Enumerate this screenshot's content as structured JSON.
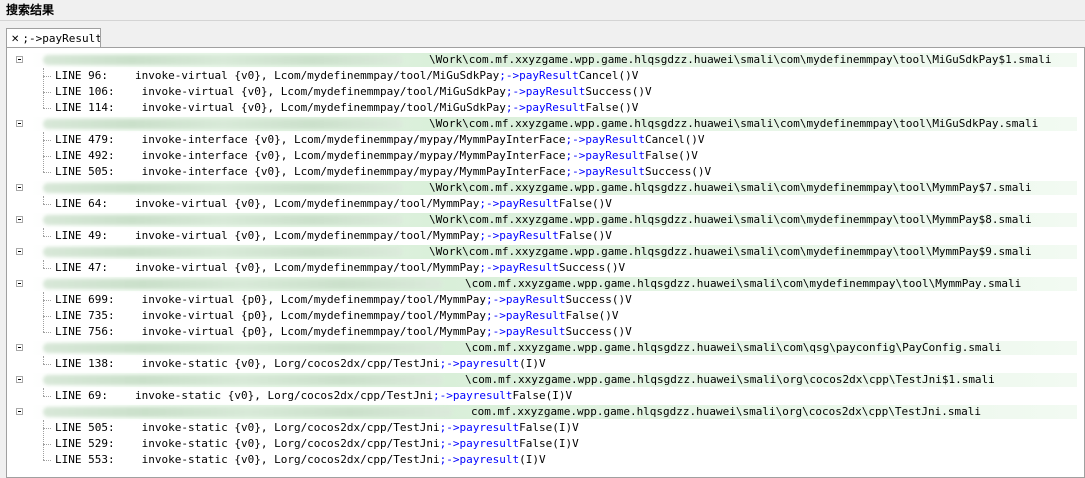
{
  "panel": {
    "title": "搜索结果"
  },
  "tab": {
    "label": ";->payResult"
  },
  "groups": [
    {
      "path": "\\Work\\com.mf.xxyzgame.wpp.game.hlqsgdzz.huawei\\smali\\com\\mydefinemmpay\\tool\\MiGuSdkPay$1.smali",
      "items": [
        {
          "line": "LINE 96:",
          "pre": "invoke-virtual {v0}, Lcom/mydefinemmpay/tool/MiGuSdkPay",
          "match": ";->payResult",
          "post": "Cancel()V"
        },
        {
          "line": "LINE 106:",
          "pre": " invoke-virtual {v0}, Lcom/mydefinemmpay/tool/MiGuSdkPay",
          "match": ";->payResult",
          "post": "Success()V"
        },
        {
          "line": "LINE 114:",
          "pre": " invoke-virtual {v0}, Lcom/mydefinemmpay/tool/MiGuSdkPay",
          "match": ";->payResult",
          "post": "False()V"
        }
      ]
    },
    {
      "path": "\\Work\\com.mf.xxyzgame.wpp.game.hlqsgdzz.huawei\\smali\\com\\mydefinemmpay\\tool\\MiGuSdkPay.smali",
      "items": [
        {
          "line": "LINE 479:",
          "pre": " invoke-interface {v0}, Lcom/mydefinemmpay/mypay/MymmPayInterFace",
          "match": ";->payResult",
          "post": "Cancel()V"
        },
        {
          "line": "LINE 492:",
          "pre": " invoke-interface {v0}, Lcom/mydefinemmpay/mypay/MymmPayInterFace",
          "match": ";->payResult",
          "post": "False()V"
        },
        {
          "line": "LINE 505:",
          "pre": " invoke-interface {v0}, Lcom/mydefinemmpay/mypay/MymmPayInterFace",
          "match": ";->payResult",
          "post": "Success()V"
        }
      ]
    },
    {
      "path": "\\Work\\com.mf.xxyzgame.wpp.game.hlqsgdzz.huawei\\smali\\com\\mydefinemmpay\\tool\\MymmPay$7.smali",
      "items": [
        {
          "line": "LINE 64:",
          "pre": "invoke-virtual {v0}, Lcom/mydefinemmpay/tool/MymmPay",
          "match": ";->payResult",
          "post": "False()V"
        }
      ]
    },
    {
      "path": "\\Work\\com.mf.xxyzgame.wpp.game.hlqsgdzz.huawei\\smali\\com\\mydefinemmpay\\tool\\MymmPay$8.smali",
      "items": [
        {
          "line": "LINE 49:",
          "pre": "invoke-virtual {v0}, Lcom/mydefinemmpay/tool/MymmPay",
          "match": ";->payResult",
          "post": "False()V"
        }
      ]
    },
    {
      "path": "\\Work\\com.mf.xxyzgame.wpp.game.hlqsgdzz.huawei\\smali\\com\\mydefinemmpay\\tool\\MymmPay$9.smali",
      "items": [
        {
          "line": "LINE 47:",
          "pre": "invoke-virtual {v0}, Lcom/mydefinemmpay/tool/MymmPay",
          "match": ";->payResult",
          "post": "Success()V"
        }
      ]
    },
    {
      "path": "\\com.mf.xxyzgame.wpp.game.hlqsgdzz.huawei\\smali\\com\\mydefinemmpay\\tool\\MymmPay.smali",
      "items": [
        {
          "line": "LINE 699:",
          "pre": " invoke-virtual {p0}, Lcom/mydefinemmpay/tool/MymmPay",
          "match": ";->payResult",
          "post": "Success()V"
        },
        {
          "line": "LINE 735:",
          "pre": " invoke-virtual {p0}, Lcom/mydefinemmpay/tool/MymmPay",
          "match": ";->payResult",
          "post": "False()V"
        },
        {
          "line": "LINE 756:",
          "pre": " invoke-virtual {p0}, Lcom/mydefinemmpay/tool/MymmPay",
          "match": ";->payResult",
          "post": "Success()V"
        }
      ]
    },
    {
      "path": "\\com.mf.xxyzgame.wpp.game.hlqsgdzz.huawei\\smali\\com\\qsg\\payconfig\\PayConfig.smali",
      "items": [
        {
          "line": "LINE 138:",
          "pre": " invoke-static {v0}, Lorg/cocos2dx/cpp/TestJni",
          "match": ";->payresult",
          "post": "(I)V"
        }
      ]
    },
    {
      "path": "\\com.mf.xxyzgame.wpp.game.hlqsgdzz.huawei\\smali\\org\\cocos2dx\\cpp\\TestJni$1.smali",
      "items": [
        {
          "line": "LINE 69:",
          "pre": "invoke-static {v0}, Lorg/cocos2dx/cpp/TestJni",
          "match": ";->payresult",
          "post": "False(I)V"
        }
      ]
    },
    {
      "path": "com.mf.xxyzgame.wpp.game.hlqsgdzz.huawei\\smali\\org\\cocos2dx\\cpp\\TestJni.smali",
      "items": [
        {
          "line": "LINE 505:",
          "pre": " invoke-static {v0}, Lorg/cocos2dx/cpp/TestJni",
          "match": ";->payresult",
          "post": "False(I)V"
        },
        {
          "line": "LINE 529:",
          "pre": " invoke-static {v0}, Lorg/cocos2dx/cpp/TestJni",
          "match": ";->payresult",
          "post": "False(I)V"
        },
        {
          "line": "LINE 553:",
          "pre": " invoke-static {v0}, Lorg/cocos2dx/cpp/TestJni",
          "match": ";->payresult",
          "post": "(I)V"
        }
      ]
    }
  ]
}
